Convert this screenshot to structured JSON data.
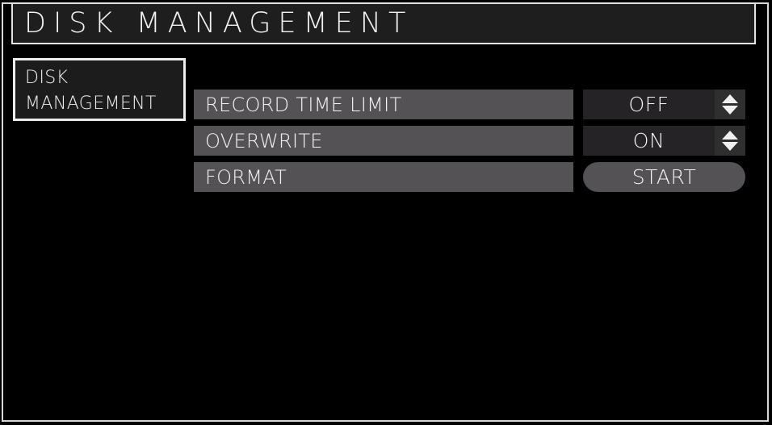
{
  "window": {
    "title": "DISK MANAGEMENT"
  },
  "colors": {
    "background": "#000000",
    "frame_border": "#d8d8d8",
    "titlebar_bg": "#1e1e1e",
    "sidebar_bg": "#1c1c1c",
    "sidebar_border": "#ececec",
    "label_bar": "#545254",
    "value_bg": "#252325",
    "spinner_bg": "#2f2f2f",
    "text": "#f4f4f4"
  },
  "sidebar": {
    "items": [
      {
        "name": "disk-management",
        "line1": "DISK",
        "line2": "MANAGEMENT",
        "selected": true
      }
    ]
  },
  "settings": {
    "rows": [
      {
        "name": "record-time-limit",
        "label": "RECORD TIME LIMIT",
        "control": "spinner",
        "value": "OFF",
        "up_icon": "triangle-up-icon",
        "down_icon": "triangle-down-icon"
      },
      {
        "name": "overwrite",
        "label": "OVERWRITE",
        "control": "spinner",
        "value": "ON",
        "up_icon": "triangle-up-icon",
        "down_icon": "triangle-down-icon"
      },
      {
        "name": "format",
        "label": "FORMAT",
        "control": "button",
        "value": "START"
      }
    ]
  }
}
